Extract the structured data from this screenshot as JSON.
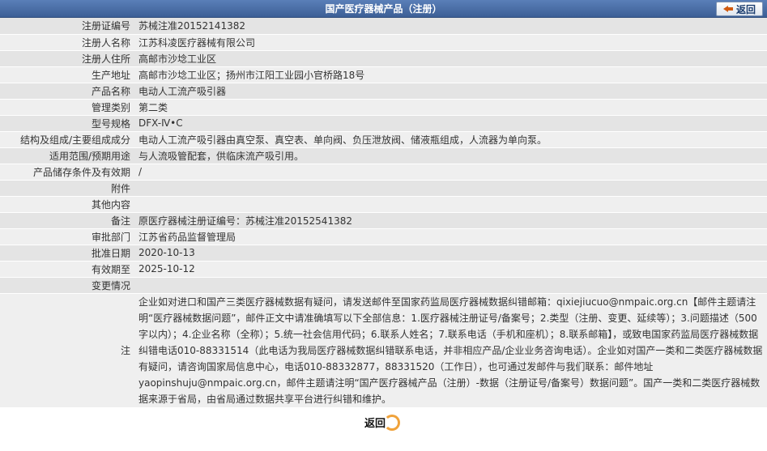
{
  "header": {
    "title": "国产医疗器械产品（注册）",
    "back_label": "返回"
  },
  "fields": [
    {
      "label": "注册证编号",
      "value": "苏械注准20152141382"
    },
    {
      "label": "注册人名称",
      "value": "江苏科凌医疗器械有限公司"
    },
    {
      "label": "注册人住所",
      "value": "高邮市沙埝工业区"
    },
    {
      "label": "生产地址",
      "value": "高邮市沙埝工业区；扬州市江阳工业园小官桥路18号"
    },
    {
      "label": "产品名称",
      "value": "电动人工流产吸引器"
    },
    {
      "label": "管理类别",
      "value": "第二类"
    },
    {
      "label": "型号规格",
      "value": "DFX-Ⅳ•C"
    },
    {
      "label": "结构及组成/主要组成成分",
      "value": "电动人工流产吸引器由真空泵、真空表、单向阀、负压泄放阀、储液瓶组成，人流器为单向泵。"
    },
    {
      "label": "适用范围/预期用途",
      "value": "与人流吸管配套，供临床流产吸引用。"
    },
    {
      "label": "产品储存条件及有效期",
      "value": "/"
    },
    {
      "label": "附件",
      "value": ""
    },
    {
      "label": "其他内容",
      "value": ""
    },
    {
      "label": "备注",
      "value": "原医疗器械注册证编号：苏械注准20152541382"
    },
    {
      "label": "审批部门",
      "value": "江苏省药品监督管理局"
    },
    {
      "label": "批准日期",
      "value": "2020-10-13"
    },
    {
      "label": "有效期至",
      "value": "2025-10-12"
    },
    {
      "label": "变更情况",
      "value": ""
    }
  ],
  "notes": {
    "label": "注",
    "text": "企业如对进口和国产三类医疗器械数据有疑问，请发送邮件至国家药监局医疗器械数据纠错邮箱：qixiejiucuo@nmpaic.org.cn【邮件主题请注明“医疗器械数据问题”，邮件正文中请准确填写以下全部信息：1.医疗器械注册证号/备案号；2.类型（注册、变更、延续等）；3.问题描述（500字以内）；4.企业名称（全称）；5.统一社会信用代码；6.联系人姓名；7.联系电话（手机和座机）；8.联系邮箱】，或致电国家药监局医疗器械数据纠错电话010-88331514（此电话为我局医疗器械数据纠错联系电话，并非相应产品/企业业务咨询电话）。企业如对国产一类和二类医疗器械数据有疑问，请咨询国家局信息中心，电话010-88332877，88331520（工作日），也可通过发邮件与我们联系：邮件地址yaopinshuju@nmpaic.org.cn，邮件主题请注明“国产医疗器械产品（注册）-数据（注册证号/备案号）数据问题”。国产一类和二类医疗器械数据来源于省局，由省局通过数据共享平台进行纠错和维护。"
  },
  "footer": {
    "back_label": "返回"
  },
  "colors": {
    "header_bg": "#4a6fa8",
    "row_dark": "#e4e4e4",
    "row_light": "#efefef",
    "accent_orange": "#f0a23a"
  }
}
